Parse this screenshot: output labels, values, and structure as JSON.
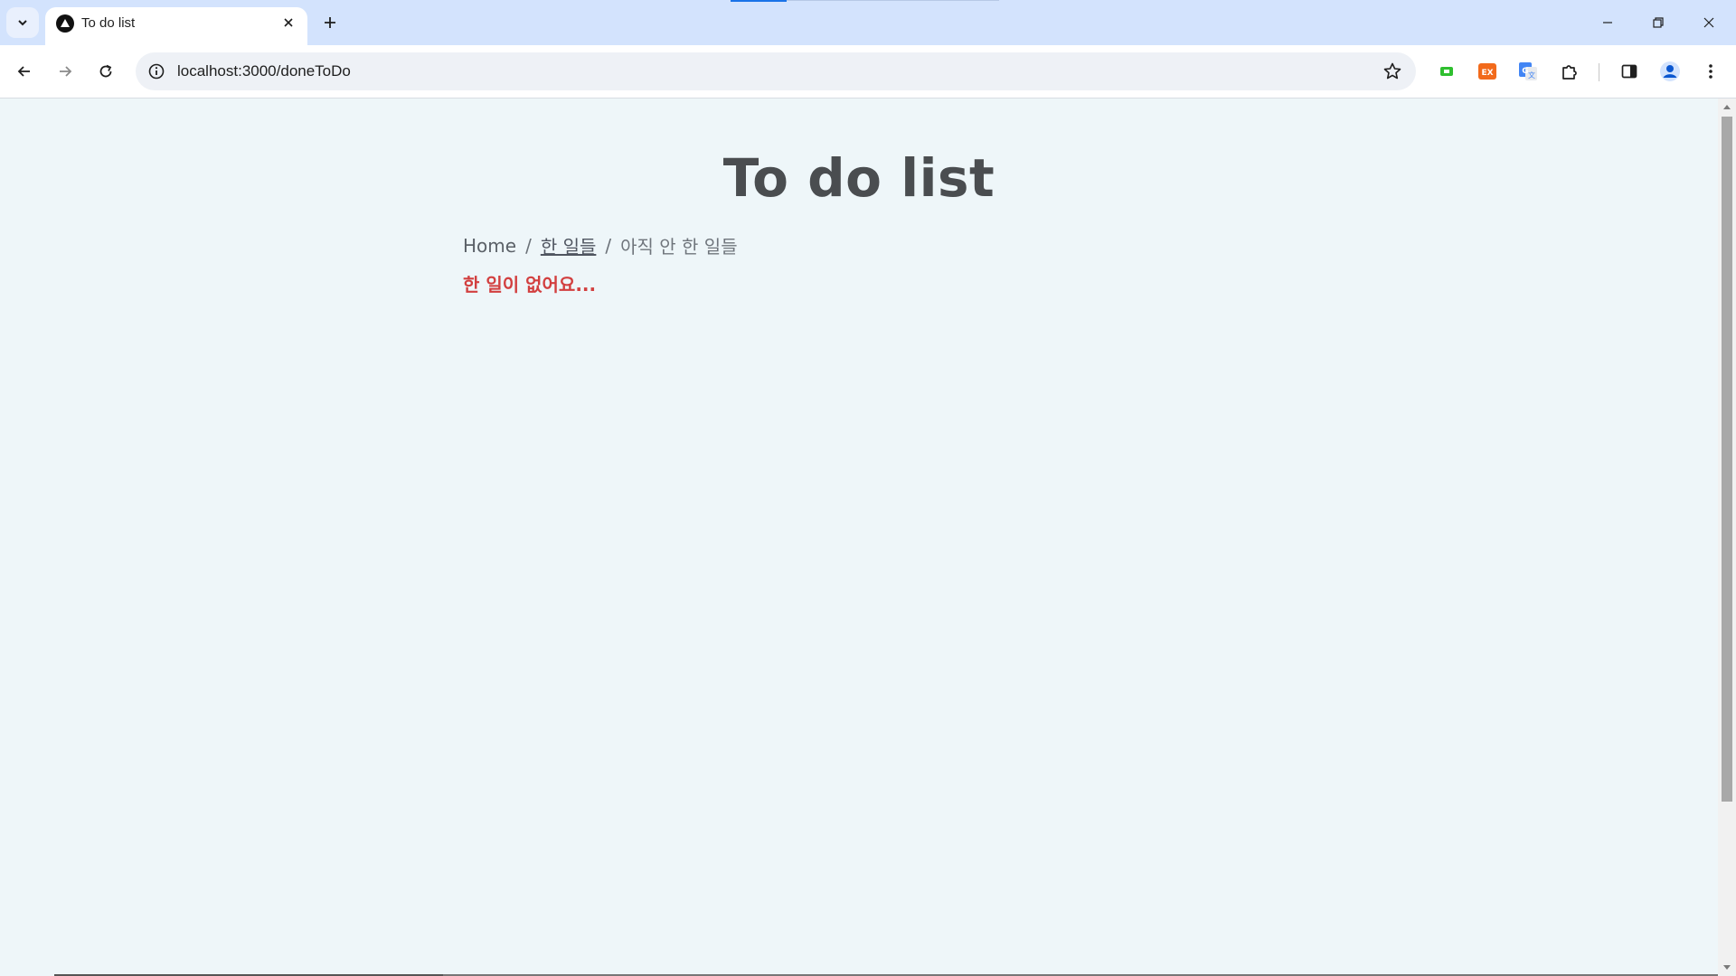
{
  "browser": {
    "tab": {
      "title": "To do list",
      "favicon": "triangle-logo-icon"
    },
    "url": "localhost:3000/doneToDo",
    "colors": {
      "tabstrip": "#d3e3fd",
      "accent": "#1a73e8"
    },
    "extensions": [
      "screen-capture-icon",
      "ex-extension-icon",
      "google-translate-icon",
      "extensions-puzzle-icon"
    ]
  },
  "page": {
    "title": "To do list",
    "breadcrumb": {
      "home": "Home",
      "separator": "/",
      "done": "한 일들",
      "current": "아직 안 한 일들"
    },
    "empty_message": "한 일이 없어요...",
    "colors": {
      "background": "#eef6f9",
      "title": "#4a4d50",
      "empty_message": "#d23f3f"
    }
  }
}
